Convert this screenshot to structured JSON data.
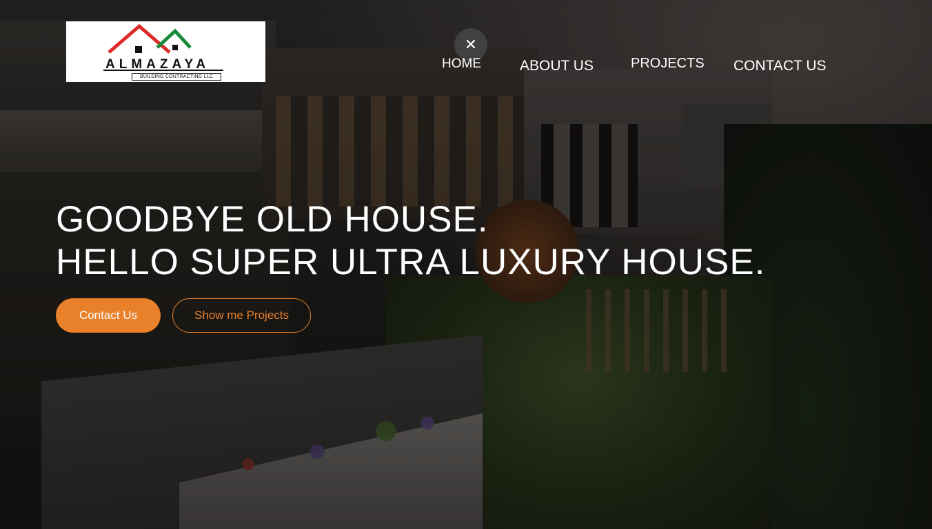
{
  "logo": {
    "name": "ALMAZAYA",
    "tagline": "BUILDING CONTRACTING LLC",
    "colors": {
      "left_roof": "#e02a2a",
      "right_roof": "#1a8a3a",
      "text": "#111111"
    }
  },
  "nav": {
    "close_icon": "close-icon",
    "items": [
      {
        "label": "HOME"
      },
      {
        "label": "ABOUT US"
      },
      {
        "label": "PROJECTS"
      },
      {
        "label": "CONTACT US"
      }
    ]
  },
  "hero": {
    "line1": "GOODBYE OLD HOUSE.",
    "line2": "HELLO SUPER ULTRA LUXURY HOUSE.",
    "primary_button": "Contact Us",
    "secondary_button": "Show me Projects",
    "accent_color": "#e8812a"
  }
}
